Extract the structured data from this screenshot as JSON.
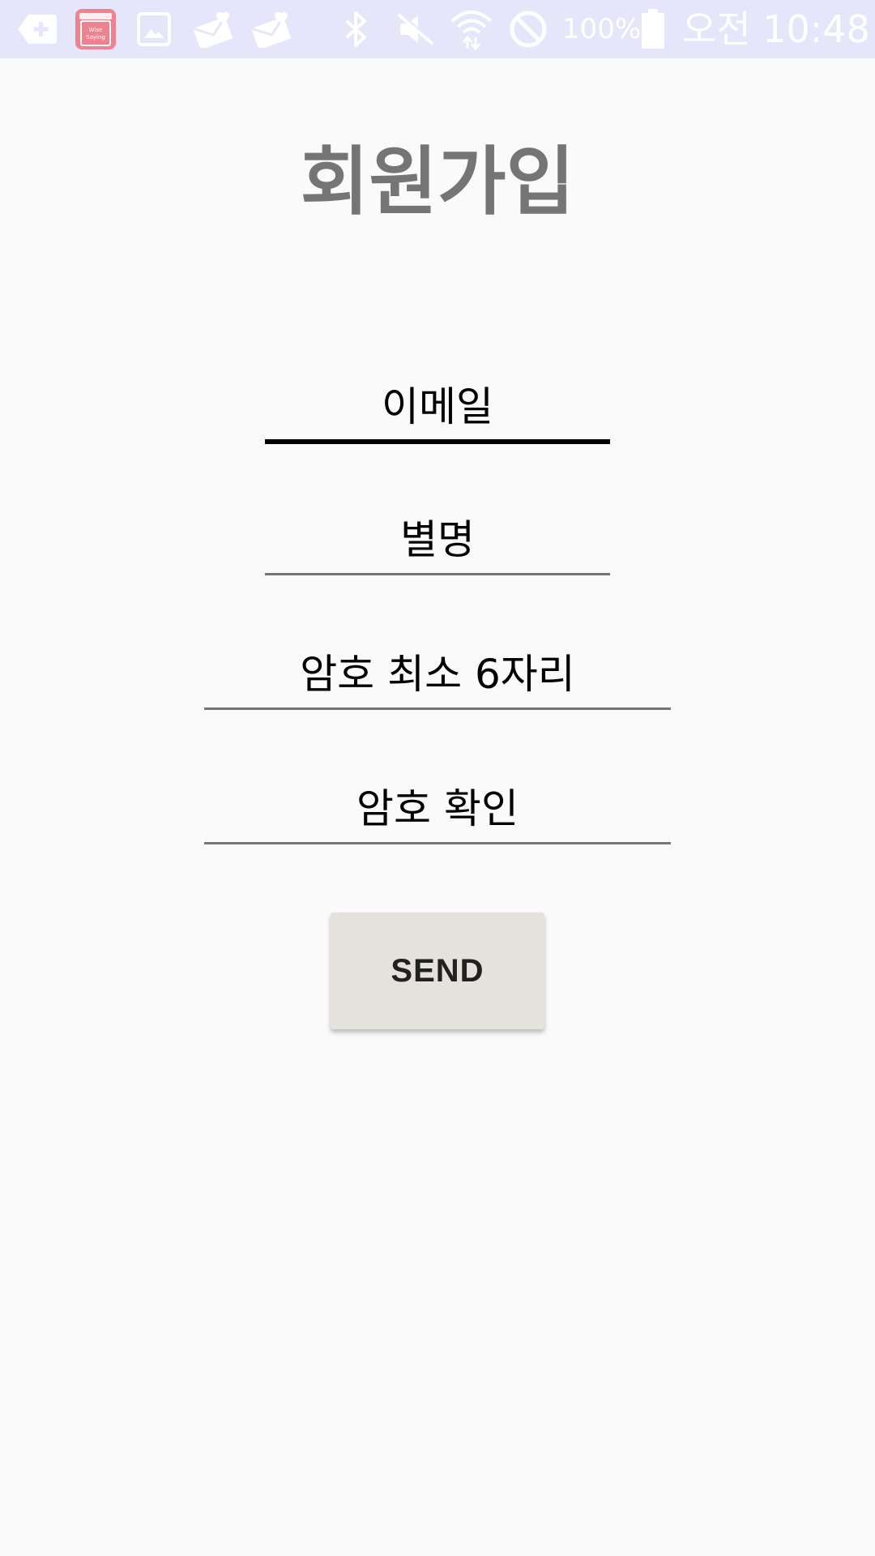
{
  "status_bar": {
    "icons": [
      "add-tag-icon",
      "wise-saying-app-icon",
      "image-icon",
      "heart-mail-icon",
      "heart-mail-icon",
      "bluetooth-icon",
      "mute-icon",
      "wifi-icon",
      "do-not-disturb-icon",
      "battery-icon"
    ],
    "app_icon_text": [
      "Wise",
      "Saying"
    ],
    "battery_percent": "100%",
    "clock": "오전 10:48",
    "background_color": "#e6e6fa",
    "app_icon_color": "#f0818f"
  },
  "page": {
    "title": "회원가입",
    "title_color": "#757575",
    "background_color": "#fafafa"
  },
  "form": {
    "email_placeholder": "이메일",
    "nickname_placeholder": "별명",
    "password_placeholder": "암호 최소 6자리",
    "confirm_placeholder": "암호 확인",
    "focused_field": "email"
  },
  "actions": {
    "send_label": "SEND",
    "send_color": "#e5e2dd"
  }
}
